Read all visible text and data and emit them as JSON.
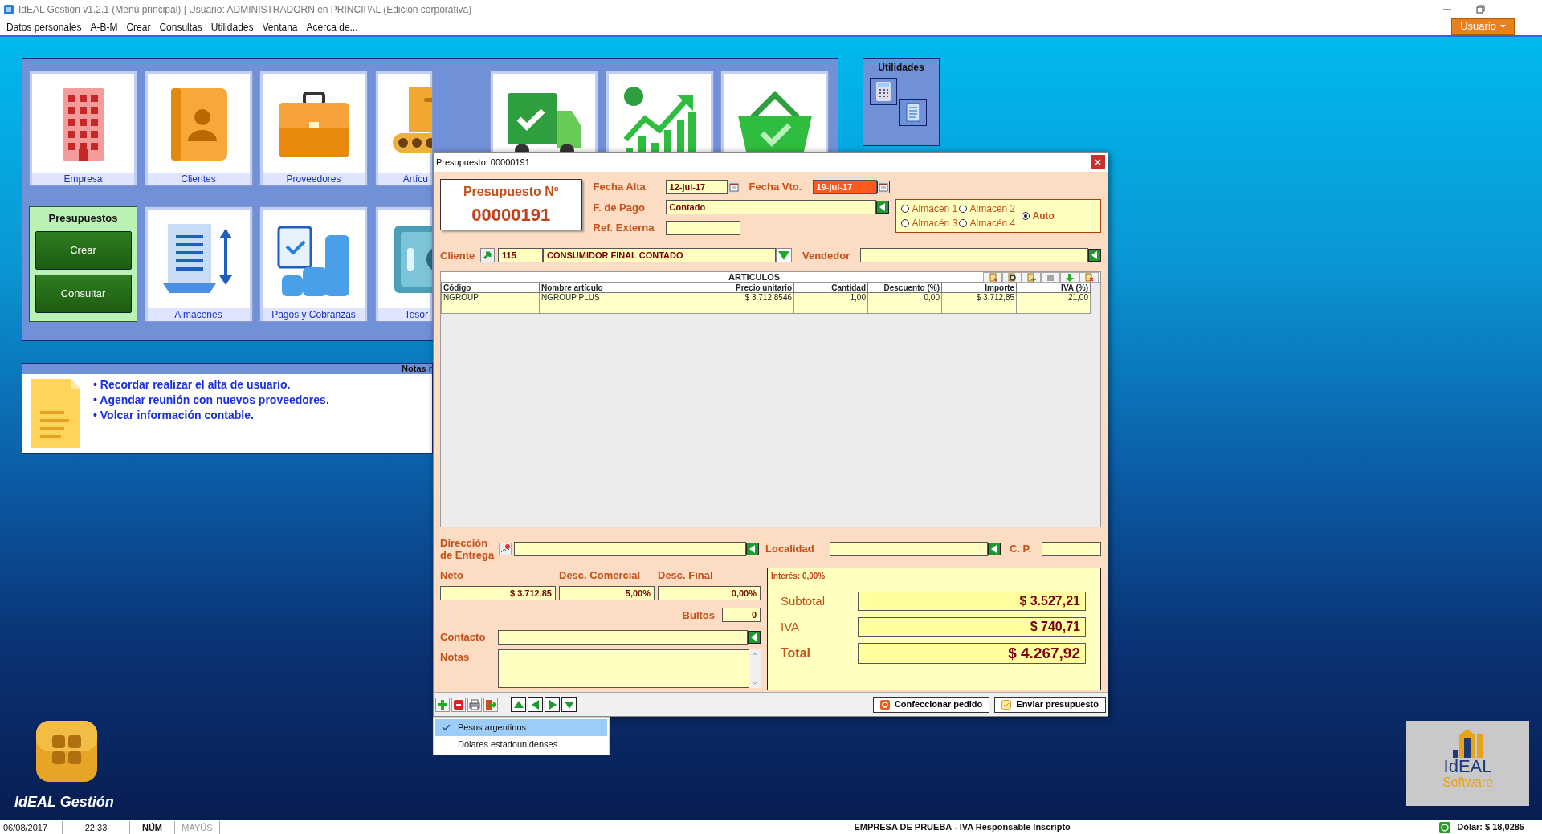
{
  "window": {
    "title": "IdEAL Gestión v1.2.1 (Menú principal) | Usuario: ADMINISTRADORN en PRINCIPAL (Edición corporativa)"
  },
  "menu": [
    "Datos personales",
    "A-B-M",
    "Crear",
    "Consultas",
    "Utilidades",
    "Ventana",
    "Acerca de..."
  ],
  "user_button": "Usuario",
  "tiles": [
    {
      "kind": "building",
      "label": "Empresa"
    },
    {
      "kind": "contacts",
      "label": "Clientes"
    },
    {
      "kind": "briefcase",
      "label": "Proveedores"
    },
    {
      "kind": "boxes",
      "label": "Artícu"
    },
    {
      "kind": "truck"
    },
    {
      "kind": "chart"
    },
    {
      "kind": "basket"
    }
  ],
  "presupuestos": {
    "title": "Presupuestos",
    "buttons": [
      "Crear",
      "Consultar"
    ]
  },
  "tiles_second_row": [
    {
      "kind": "list",
      "label": "Almacenes"
    },
    {
      "kind": "payments",
      "label": "Pagos y Cobranzas"
    },
    {
      "kind": "safe",
      "label": "Tesor"
    }
  ],
  "utilities": {
    "title": "Utilidades"
  },
  "notes": {
    "title": "Notas r",
    "items": [
      "• Recordar realizar el alta de usuario.",
      "• Agendar reunión con nuevos proveedores.",
      "• Volcar información contable."
    ]
  },
  "dialog": {
    "title": "Presupuesto: 00000191",
    "heading": "Presupuesto Nº",
    "number": "00000191",
    "fecha_alta": {
      "label": "Fecha Alta",
      "value": "12-jul-17"
    },
    "fecha_vto": {
      "label": "Fecha Vto.",
      "value": "19-jul-17"
    },
    "forma_pago": {
      "label": "F. de Pago",
      "value": "Contado"
    },
    "ref_externa": {
      "label": "Ref. Externa"
    },
    "warehouses": [
      {
        "label": "Almacén 1",
        "selected": false
      },
      {
        "label": "Almacén 2",
        "selected": false
      },
      {
        "label": "Almacén 3",
        "selected": false
      },
      {
        "label": "Almacén 4",
        "selected": false
      },
      {
        "label": "Auto",
        "selected": true
      }
    ],
    "cliente": {
      "label": "Cliente",
      "code": "115",
      "name": "CONSUMIDOR FINAL CONTADO"
    },
    "vendedor": {
      "label": "Vendedor"
    },
    "table": {
      "title": "ARTICULOS",
      "columns": [
        "Código",
        "Nombre artículo",
        "Precio unitario",
        "Cantidad",
        "Descuento (%)",
        "Importe",
        "IVA (%)"
      ],
      "rows": [
        [
          "NGROUP",
          "NGROUP PLUS",
          "$ 3.712,8546",
          "1,00",
          "0,00",
          "$ 3.712,85",
          "21,00"
        ]
      ]
    },
    "direccion": {
      "label": "Dirección de Entrega"
    },
    "localidad": {
      "label": "Localidad"
    },
    "cp": {
      "label": "C. P."
    },
    "neto": {
      "label": "Neto",
      "value": "$ 3.712,85"
    },
    "desc_comercial": {
      "label": "Desc. Comercial",
      "value": "5,00%"
    },
    "desc_final": {
      "label": "Desc. Final",
      "value": "0,00%"
    },
    "bultos": {
      "label": "Bultos",
      "value": "0"
    },
    "contacto": {
      "label": "Contacto"
    },
    "notas": {
      "label": "Notas"
    },
    "interest": "Interés: 0,00%",
    "totals": [
      {
        "kind": "normal",
        "label": "Subtotal",
        "value": "$ 3.527,21"
      },
      {
        "kind": "normal",
        "label": "IVA",
        "value": "$ 740,71"
      },
      {
        "kind": "grand",
        "label": "Total",
        "value": "$ 4.267,92"
      }
    ],
    "actions": [
      "Confeccionar pedido",
      "Enviar presupuesto"
    ]
  },
  "currency_menu": [
    {
      "label": "Pesos argentinos",
      "selected": true
    },
    {
      "label": "Dólares estadounidenses",
      "selected": false
    }
  ],
  "app_logo": {
    "label": "IdEAL Gestión"
  },
  "brand_logo": {
    "name": "IdEAL",
    "tagline": "Software"
  },
  "status_bar": {
    "date": "06/08/2017",
    "time": "22:33",
    "keys": [
      {
        "label": "NÚM",
        "on": true
      },
      {
        "label": "MAYÚS",
        "on": false
      }
    ],
    "company": "EMPRESA DE PRUEBA - IVA Responsable Inscripto",
    "dollar": "Dólar: $ 18,0285"
  }
}
